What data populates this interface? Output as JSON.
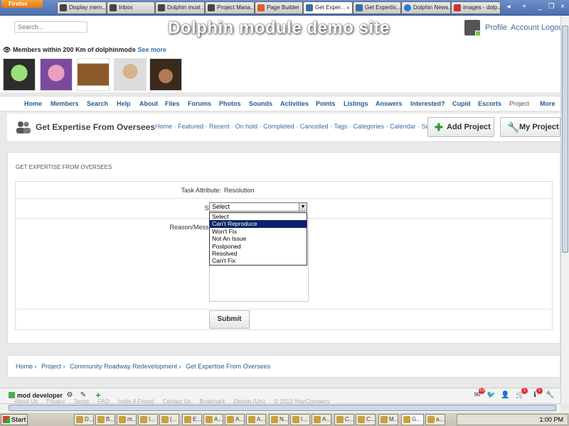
{
  "browser": {
    "app_button": "Firefox",
    "tabs": [
      {
        "label": "Display mem..."
      },
      {
        "label": "Inbox"
      },
      {
        "label": "Dolphin must ..."
      },
      {
        "label": "Project Mana..."
      },
      {
        "label": "Page Builder"
      },
      {
        "label": "Get Exper...",
        "active": true
      },
      {
        "label": "Get Expertis..."
      },
      {
        "label": "Dolphin News..."
      },
      {
        "label": "images - dolp..."
      }
    ]
  },
  "header": {
    "search_placeholder": "Search...",
    "site_title": "Dolphin module demo site",
    "links": [
      "Profile",
      "Account",
      "Logout"
    ]
  },
  "members": {
    "heading": "Members within 200 Km of dolphinmods",
    "see_more": "See more",
    "avatars": [
      "green-cartoon-avatar",
      "purple-cartoon-avatar",
      "suitcase-avatar",
      "man-photo-avatar",
      "woman-photo-avatar"
    ]
  },
  "nav": {
    "items": [
      "Home",
      "Members",
      "Search",
      "Help",
      "About",
      "Files",
      "Forums",
      "Photos",
      "Sounds",
      "Activities",
      "Points",
      "Listings",
      "Answers",
      "Interested?",
      "Cupid",
      "Escorts",
      "Project",
      "More"
    ]
  },
  "subheader": {
    "title": "Get Expertise From Oversees",
    "links": [
      "Home",
      "Featured",
      "Recent",
      "On hold",
      "Completed",
      "Cancelled",
      "Tags",
      "Categories",
      "Calendar",
      "Search"
    ],
    "add_button": "Add Project",
    "my_button": "My Project"
  },
  "form": {
    "box_title": "GET EXPERTISE FROM OVERSEES",
    "task_attribute_label": "Task Attribute:",
    "task_attribute_value": "Resolution",
    "state_label": "State:",
    "state_value": "Select",
    "state_options": [
      "Select",
      "Can't Reproduce",
      "Won't Fix",
      "Not An Issue",
      "Postponed",
      "Resolved",
      "Can't Fix"
    ],
    "highlighted_option": 1,
    "reason_label": "Reason/Message:",
    "submit_label": "Submit"
  },
  "breadcrumb": [
    "Home",
    "Project",
    "Community Roadway Redevelopment",
    "Get Expertise From Oversees"
  ],
  "footer": {
    "links": [
      "About Us",
      "Privacy",
      "Terms",
      "FAQ",
      "Invite A Friend",
      "Contact Us",
      "Bookmark",
      "Design (Uni)",
      "© 2013 YourCompany"
    ],
    "user": "mod developer",
    "badges": {
      "mail": "13",
      "cart": "1",
      "info": "1"
    }
  },
  "taskbar": {
    "start": "Start",
    "buttons": [
      "D...",
      "B...",
      "m...",
      "I...",
      "(...",
      "E...",
      "A...",
      "A...",
      "A...",
      "N...",
      "I...",
      "A...",
      "C...",
      "C...",
      "M...",
      "G...",
      "a..."
    ],
    "clock": "1:00 PM"
  }
}
